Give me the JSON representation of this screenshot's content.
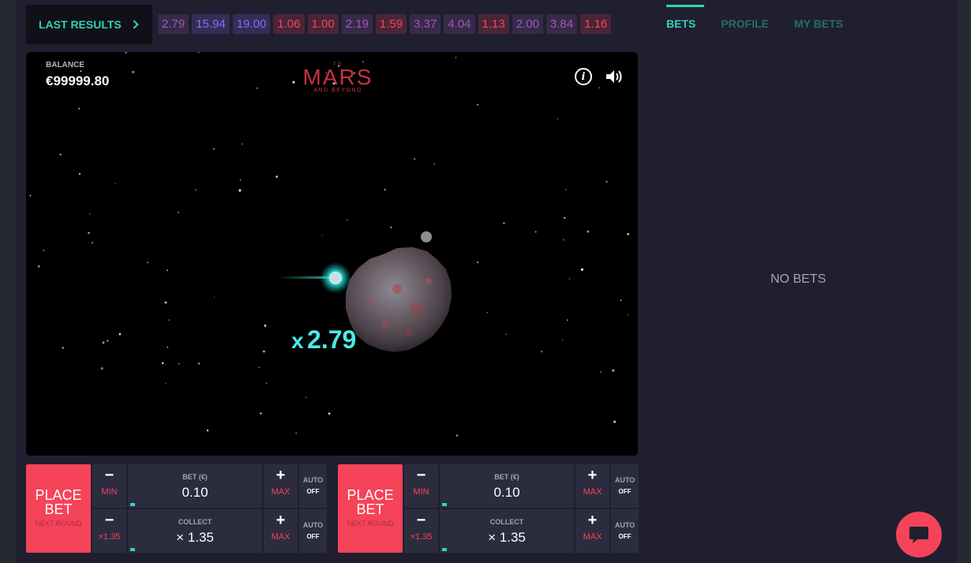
{
  "results_bar": {
    "label": "LAST RESULTS",
    "results": [
      {
        "value": "2.79",
        "color": "#9b59b6"
      },
      {
        "value": "15.94",
        "color": "#8b6cf5"
      },
      {
        "value": "19.00",
        "color": "#8b6cf5"
      },
      {
        "value": "1.06",
        "color": "#f5435a"
      },
      {
        "value": "1.00",
        "color": "#f5435a"
      },
      {
        "value": "2.19",
        "color": "#9b59b6"
      },
      {
        "value": "1.59",
        "color": "#f5435a"
      },
      {
        "value": "3.37",
        "color": "#9b59b6"
      },
      {
        "value": "4.04",
        "color": "#9b59b6"
      },
      {
        "value": "1.13",
        "color": "#f5435a"
      },
      {
        "value": "2.00",
        "color": "#9b59b6"
      },
      {
        "value": "3.84",
        "color": "#9b59b6"
      },
      {
        "value": "1.16",
        "color": "#f5435a"
      }
    ]
  },
  "game": {
    "balance_label": "BALANCE",
    "balance_value": "€99999.80",
    "logo_top": "TO",
    "logo_main": "MARS",
    "logo_bottom": "AND BEYOND",
    "multiplier_prefix": "x",
    "multiplier_value": "2.79"
  },
  "bet_panels": [
    {
      "place_label_1": "PLACE",
      "place_label_2": "BET",
      "next_round": "NEXT ROUND",
      "minus": "−",
      "plus": "+",
      "min_label": "MIN",
      "max_label": "MAX",
      "bet_label": "BET (€)",
      "bet_value": "0.10",
      "auto_label": "AUTO",
      "auto_value": "OFF",
      "collect_label": "COLLECT",
      "collect_value": "× 1.35",
      "collect_min_label": "×1.35"
    },
    {
      "place_label_1": "PLACE",
      "place_label_2": "BET",
      "next_round": "NEXT ROUND",
      "minus": "−",
      "plus": "+",
      "min_label": "MIN",
      "max_label": "MAX",
      "bet_label": "BET (€)",
      "bet_value": "0.10",
      "auto_label": "AUTO",
      "auto_value": "OFF",
      "collect_label": "COLLECT",
      "collect_value": "× 1.35",
      "collect_min_label": "×1.35"
    }
  ],
  "sidebar": {
    "tabs": [
      "BETS",
      "PROFILE",
      "MY BETS"
    ],
    "empty_text": "NO BETS"
  },
  "colors": {
    "accent": "#35d1b9",
    "danger": "#f5435a",
    "multiplier": "#48ece8"
  }
}
